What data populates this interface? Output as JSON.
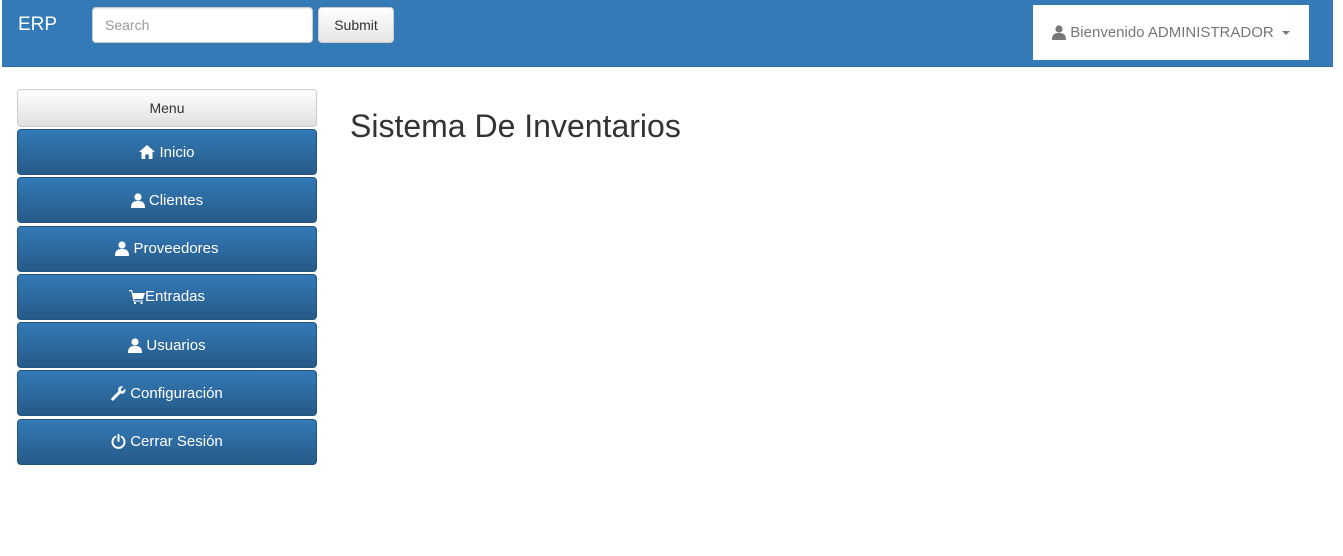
{
  "navbar": {
    "brand": "ERP",
    "search_placeholder": "Search",
    "submit_label": "Submit",
    "user_label": "Bienvenido ADMINISTRADOR",
    "user_icon": "user-icon",
    "background_color": "#337ab7"
  },
  "sidebar": {
    "header": "Menu",
    "items": [
      {
        "label": "Inicio",
        "icon": "home-icon"
      },
      {
        "label": "Clientes",
        "icon": "user-icon"
      },
      {
        "label": "Proveedores",
        "icon": "user-icon"
      },
      {
        "label": "Entradas",
        "icon": "cart-icon"
      },
      {
        "label": "Usuarios",
        "icon": "user-icon"
      },
      {
        "label": "Configuración",
        "icon": "wrench-icon"
      },
      {
        "label": "Cerrar Sesión",
        "icon": "power-icon"
      }
    ]
  },
  "main": {
    "title": "Sistema De Inventarios"
  }
}
